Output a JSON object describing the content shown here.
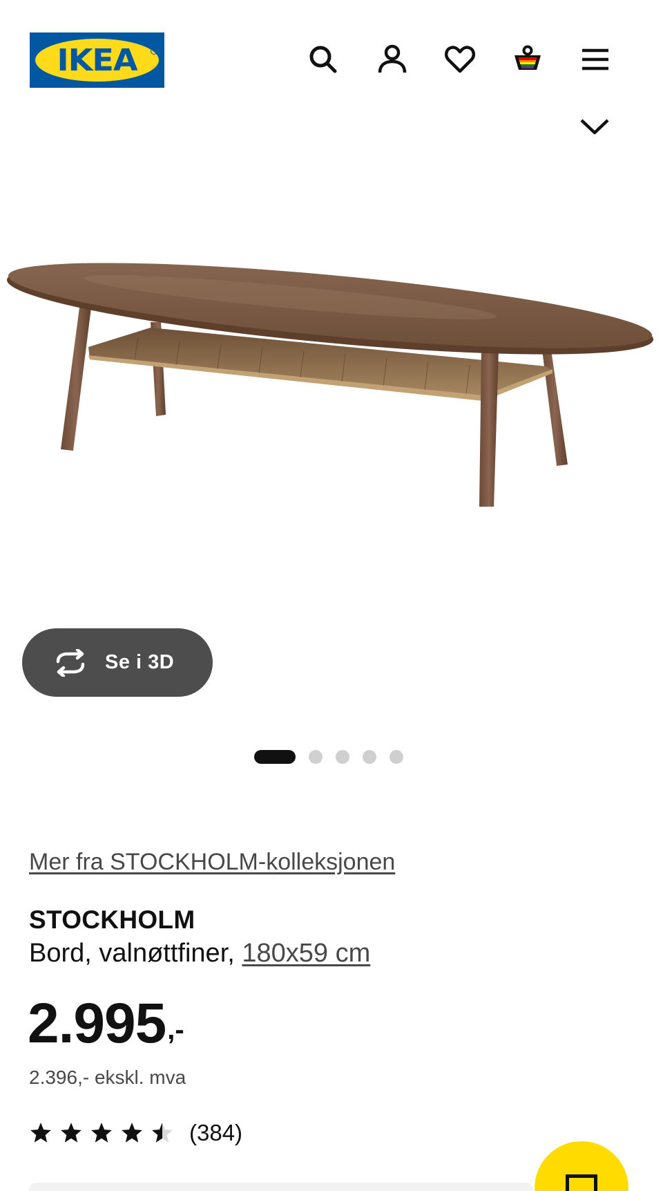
{
  "header": {
    "logo_text": "IKEA",
    "icons": [
      "search-icon",
      "account-icon",
      "heart-icon",
      "basket-icon",
      "menu-icon"
    ]
  },
  "gallery": {
    "view_3d_label": "Se i 3D",
    "current_slide": 1,
    "total_slides": 5
  },
  "product": {
    "collection_link": "Mer fra STOCKHOLM-kolleksjonen",
    "name": "STOCKHOLM",
    "description": "Bord, valnøttfiner,",
    "size": "180x59 cm",
    "price": "2.995",
    "price_suffix": ",-",
    "price_ex_vat": "2.396,- ekskl. mva",
    "rating": 4.5,
    "rating_max": 5,
    "review_count": "(384)"
  },
  "colors": {
    "ikea_blue": "#0058a3",
    "ikea_yellow": "#ffda1a",
    "button_dark": "#4d4d4d"
  }
}
